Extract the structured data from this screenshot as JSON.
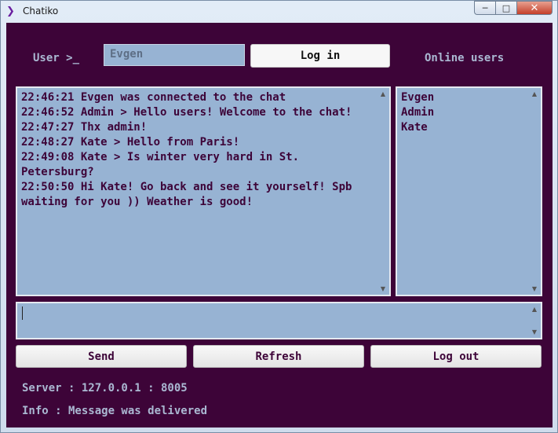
{
  "window": {
    "title": "Chatiko",
    "app_icon": "terminal-prompt-icon",
    "controls": {
      "minimize": "minimize-icon",
      "maximize": "maximize-icon",
      "close": "close-icon"
    }
  },
  "colors": {
    "background": "#3d0438",
    "panel": "#97b3d3",
    "label_text": "#aab8d2",
    "chat_text": "#3d0438"
  },
  "header": {
    "user_label": "User >_",
    "user_value": "Evgen",
    "login_label": "Log in",
    "online_label": "Online users"
  },
  "chat": {
    "messages": [
      "22:46:21 Evgen was connected to the chat",
      "22:46:52 Admin > Hello users! Welcome to the chat!",
      "22:47:27 Thx admin!",
      "22:48:27 Kate > Hello from Paris!",
      "22:49:08 Kate > Is winter very hard in St. Petersburg?",
      "22:50:50 Hi Kate! Go back and see it yourself! Spb waiting for you )) Weather is good!"
    ]
  },
  "users": [
    "Evgen",
    "Admin",
    "Kate"
  ],
  "message_input": {
    "value": ""
  },
  "buttons": {
    "send": "Send",
    "refresh": "Refresh",
    "logout": "Log out"
  },
  "status": {
    "server": "Server : 127.0.0.1 : 8005",
    "info": "Info : Message was delivered"
  }
}
